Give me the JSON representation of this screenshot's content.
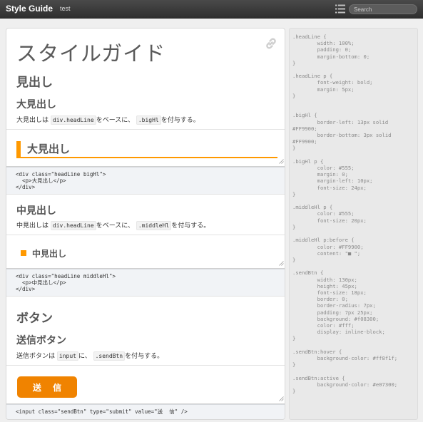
{
  "topbar": {
    "brand": "Style Guide",
    "project": "test",
    "search_placeholder": "Search",
    "colors": {
      "bar": "#3a3a3a"
    }
  },
  "icons": {
    "list": "list-icon",
    "link": "link-icon"
  },
  "main": {
    "title": "スタイルガイド",
    "section_heading": "見出し",
    "big": {
      "heading": "大見出し",
      "desc_pre": "大見出しは",
      "desc_code1": "div.headLine",
      "desc_mid": "をベースに、",
      "desc_code2": ".bigHl",
      "desc_post": "を付与する。",
      "demo_text": "大見出し",
      "code": "<div class=\"headLine bigHl\">\n  <p>大見出し</p>\n</div>"
    },
    "middle": {
      "heading": "中見出し",
      "desc_pre": "中見出しは",
      "desc_code1": "div.headLine",
      "desc_mid": "をベースに、",
      "desc_code2": ".middleHl",
      "desc_post": "を付与する。",
      "demo_text": "中見出し",
      "code": "<div class=\"headLine middleHl\">\n  <p>中見出し</p>\n</div>"
    },
    "button_heading": "ボタン",
    "send": {
      "heading": "送信ボタン",
      "desc_pre": "送信ボタンは",
      "desc_code1": "input",
      "desc_mid": "に、",
      "desc_code2": ".sendBtn",
      "desc_post": "を付与する。",
      "button_label": "送 信",
      "code": "<input class=\"sendBtn\" type=\"submit\" value=\"送  信\" />"
    },
    "colors": {
      "accent": "#FF9900",
      "button": "#f08300"
    }
  },
  "css_panel": {
    "text": ".headLine {\n        width: 100%;\n        padding: 0;\n        margin-bottom: 0;\n}\n\n.headLine p {\n        font-weight: bold;\n        margin: 5px;\n}\n\n\n.bigHl {\n        border-left: 13px solid\n#FF9900;\n        border-bottom: 3px solid\n#FF9900;\n}\n\n.bigHl p {\n        color: #555;\n        margin: 0;\n        margin-left: 10px;\n        font-size: 24px;\n}\n\n.middleHl p {\n        color: #555;\n        font-size: 20px;\n}\n\n.middleHl p:before {\n        color: #FF9900;\n        content: \"■ \";\n}\n\n.sendBtn {\n        width: 130px;\n        height: 45px;\n        font-size: 18px;\n        border: 0;\n        border-radius: 7px;\n        padding: 7px 25px;\n        background: #f08300;\n        color: #fff;\n        display: inline-block;\n}\n\n.sendBtn:hover {\n        background-color: #ff8f1f;\n}\n\n.sendBtn:active {\n        background-color: #e07300;\n}"
  }
}
